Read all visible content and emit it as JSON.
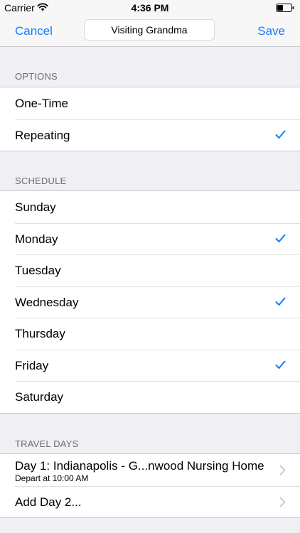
{
  "status_bar": {
    "carrier": "Carrier",
    "time": "4:36 PM"
  },
  "nav": {
    "cancel_label": "Cancel",
    "title_value": "Visiting Grandma",
    "save_label": "Save"
  },
  "options": {
    "header": "OPTIONS",
    "items": [
      {
        "label": "One-Time",
        "checked": false
      },
      {
        "label": "Repeating",
        "checked": true
      }
    ]
  },
  "schedule": {
    "header": "SCHEDULE",
    "days": [
      {
        "label": "Sunday",
        "checked": false
      },
      {
        "label": "Monday",
        "checked": true
      },
      {
        "label": "Tuesday",
        "checked": false
      },
      {
        "label": "Wednesday",
        "checked": true
      },
      {
        "label": "Thursday",
        "checked": false
      },
      {
        "label": "Friday",
        "checked": true
      },
      {
        "label": "Saturday",
        "checked": false
      }
    ]
  },
  "travel_days": {
    "header": "TRAVEL DAYS",
    "items": [
      {
        "title": "Day 1: Indianapolis - G...nwood Nursing Home",
        "subtitle": "Depart at 10:00 AM"
      },
      {
        "title": "Add Day 2..."
      }
    ]
  },
  "colors": {
    "accent": "#147efb",
    "section_header": "#6d6d72",
    "background": "#efeff4"
  },
  "icons": {
    "check": "checkmark-icon",
    "chevron": "chevron-right-icon",
    "wifi": "wifi-icon",
    "battery": "battery-icon"
  }
}
